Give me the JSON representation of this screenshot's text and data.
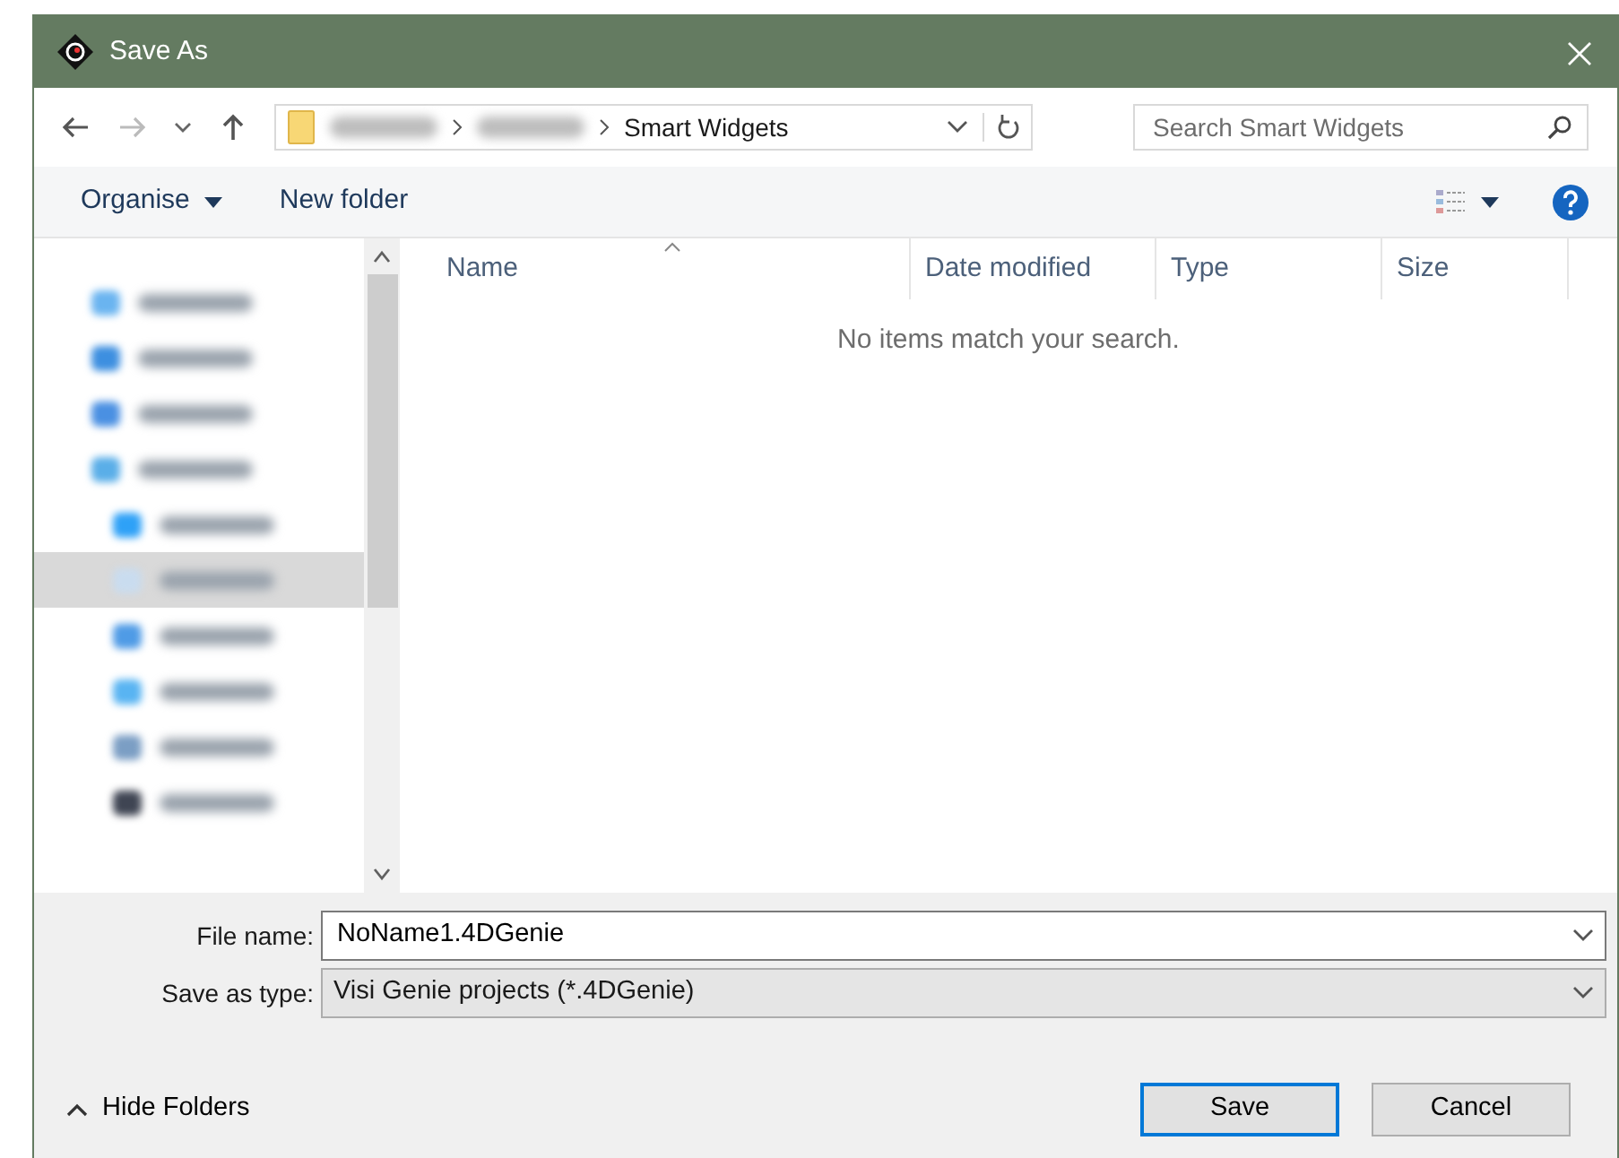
{
  "window": {
    "title": "Save As"
  },
  "address": {
    "segments": [
      {
        "kind": "blurred"
      },
      {
        "kind": "blurred"
      },
      {
        "kind": "text",
        "label": "Smart Widgets"
      }
    ]
  },
  "search": {
    "placeholder": "Search Smart Widgets"
  },
  "toolbar": {
    "organise": "Organise",
    "new_folder": "New folder"
  },
  "sidebar": {
    "items": [
      {
        "color": "#6ab4f0",
        "selected": false
      },
      {
        "color": "#3d8fe0",
        "selected": false
      },
      {
        "color": "#4a90e2",
        "selected": false
      },
      {
        "color": "#5aaee8",
        "selected": false,
        "children": [
          {
            "color": "#2ea1f7",
            "selected": false
          },
          {
            "color": "#c9dcef",
            "selected": true
          },
          {
            "color": "#4f9be6",
            "selected": false
          },
          {
            "color": "#59b4f2",
            "selected": false
          },
          {
            "color": "#7b9ec4",
            "selected": false
          },
          {
            "color": "#3f4553",
            "selected": false
          }
        ]
      }
    ]
  },
  "table": {
    "columns": [
      "Name",
      "Date modified",
      "Type",
      "Size"
    ],
    "empty_message": "No items match your search."
  },
  "form": {
    "file_name_label": "File name:",
    "file_name": "NoName1.4DGenie",
    "type_label": "Save as type:",
    "type": "Visi Genie projects (*.4DGenie)"
  },
  "hide_folders": "Hide Folders",
  "buttons": [
    {
      "label": "Save",
      "default": true
    },
    {
      "label": "Cancel",
      "default": false
    }
  ]
}
